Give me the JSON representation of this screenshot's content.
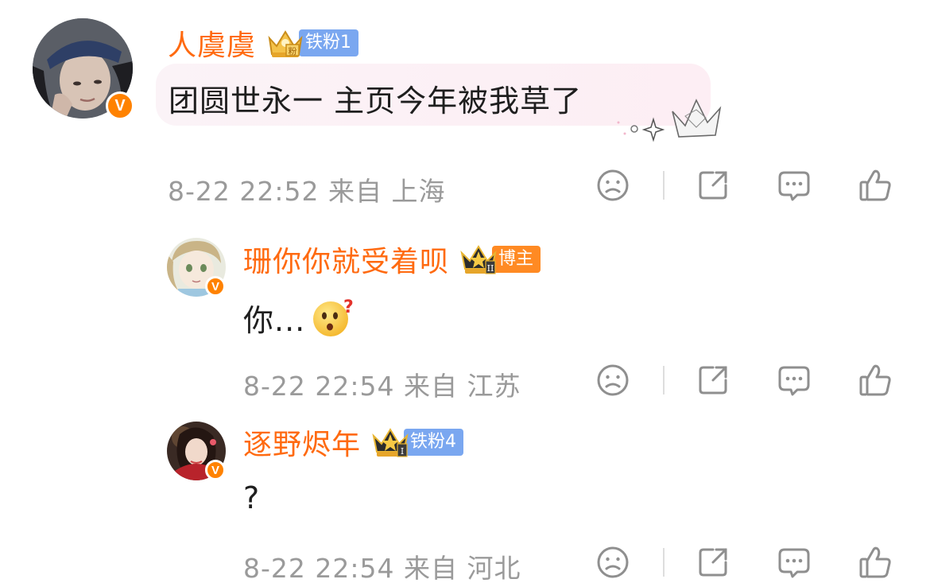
{
  "comments": [
    {
      "username": "人虞虞",
      "tag": "铁粉1",
      "text": "团圆世永一 主页今年被我草了",
      "meta": "8-22 22:52 来自 上海",
      "verified": "V"
    },
    {
      "username": "珊你你就受着呗",
      "tag": "博主",
      "text": "你...",
      "meta": "8-22 22:54 来自 江苏",
      "verified": "V"
    },
    {
      "username": "逐野烬年",
      "tag": "铁粉4",
      "text": "?",
      "meta": "8-22 22:54 来自 河北",
      "verified": "V"
    }
  ],
  "icons": {
    "dislike": "frown-face-icon",
    "share": "share-icon",
    "comment": "comment-bubble-icon",
    "like": "thumbs-up-icon"
  },
  "colors": {
    "username": "#ff6a10",
    "fan_tag": "#7aa7f0",
    "host_tag": "#ff8a23",
    "verified": "#ff8200",
    "meta_text": "#9a9a9a",
    "icon": "#8f8f8f"
  }
}
